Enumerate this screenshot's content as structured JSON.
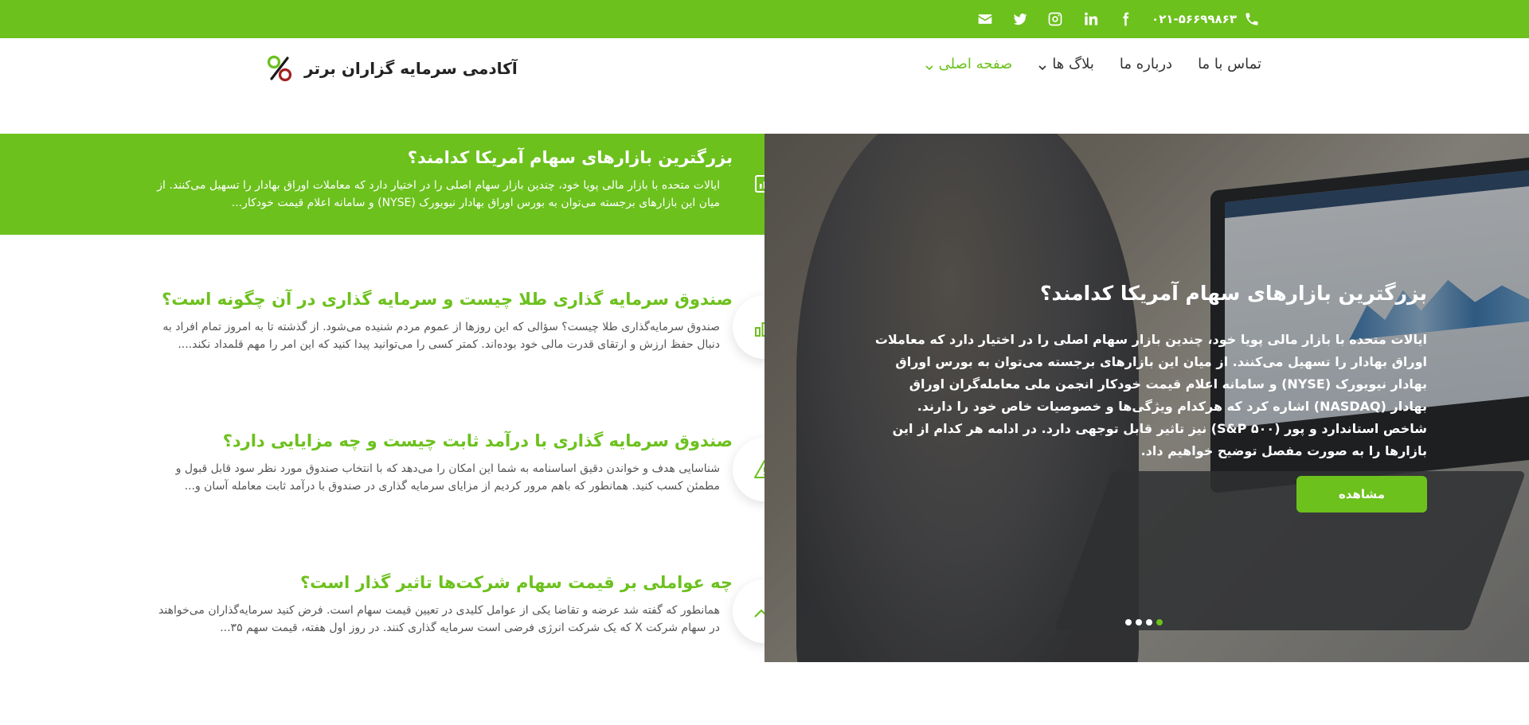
{
  "colors": {
    "accent": "#6cc11d",
    "header_bg": "#ffffff"
  },
  "topbar": {
    "phone": "۰۲۱-۵۶۶۹۹۸۶۳",
    "icons": [
      "phone-icon",
      "facebook-icon",
      "linkedin-icon",
      "instagram-icon",
      "twitter-icon",
      "mail-icon"
    ]
  },
  "nav": {
    "items": [
      {
        "label": "صفحه اصلی",
        "active": true,
        "has_dropdown": true
      },
      {
        "label": "بلاگ ها",
        "active": false,
        "has_dropdown": true
      },
      {
        "label": "درباره ما",
        "active": false,
        "has_dropdown": false
      },
      {
        "label": "تماس با ما",
        "active": false,
        "has_dropdown": false
      }
    ]
  },
  "logo": {
    "text": "آکادمی سرمایه گزاران برتر"
  },
  "posts": [
    {
      "title": "بزرگترین بازارهای سهام آمریکا کدامند؟",
      "excerpt": "ایالات متحده با بازار مالی پویا خود، چندین بازار سهام اصلی را در اختیار دارد که معاملات اوراق بهادار را تسهیل می‌کنند. از میان این بازارهای برجسته می‌توان به بورس اوراق بهادار نیویورک (NYSE) و سامانه اعلام قیمت خودکار...",
      "icon": "chart-board-icon"
    },
    {
      "title": "صندوق سرمایه گذاری طلا چیست و سرمایه گذاری در آن چگونه است؟",
      "excerpt": "صندوق سرمایه‌گذاری طلا چیست؟ سؤالی که این روزها از عموم مردم شنیده می‌شود. از گذشته تا به امروز تمام افراد به دنبال حفظ ارزش و ارتقای قدرت مالی خود بوده‌اند. کمتر کسی را می‌توانید پیدا کنید که این امر را مهم قلمداد نکند....",
      "icon": "bar-chart-icon"
    },
    {
      "title": "صندوق سرمایه گذاری با درآمد ثابت چیست و چه مزایایی دارد؟",
      "excerpt": "شناسایی هدف و خواندن دقیق اساسنامه به شما این امکان را می‌دهد که با انتخاب صندوق مورد نظر سود قابل قبول و مطمئن کسب کنید. همانطور که باهم مرور کردیم از مزایای سرمایه گذاری در صندوق با درآمد ثابت معامله آسان و...",
      "icon": "warning-icon"
    },
    {
      "title": "چه عواملی بر قیمت سهام شرکت‌ها تاثیر گذار است؟",
      "excerpt": "همانطور که گفته شد عرضه و تقاضا یکی از عوامل کلیدی در تعیین قیمت سهام است. فرض کنید سرمایه‌گذاران می‌خواهند در سهام شرکت X که یک شرکت انرژی فرضی است سرمایه گذاری کنند. در روز اول هفته، قیمت سهم ۳۵...",
      "icon": "trending-up-icon"
    }
  ],
  "slider": {
    "title": "بزرگترین بازارهای سهام آمریکا کدامند؟",
    "text": "ایالات متحده با بازار مالی پویا خود، چندین بازار سهام اصلی را در اختیار دارد که معاملات اوراق بهادار را تسهیل می‌کنند. از میان این بازارهای برجسته می‌توان به بورس اوراق بهادار نیویورک (NYSE) و سامانه اعلام قیمت خودکار انجمن ملی معامله‌گران اوراق بهادار (NASDAQ) اشاره کرد که هرکدام ویژگی‌ها و خصوصیات خاص خود را دارند. شاخص استاندارد و پور (S&P ۵۰۰) نیز تاثیر قابل توجهی دارد. در ادامه هر کدام از این بازارها را به صورت مفصل توضیح خواهیم داد.",
    "button_label": "مشاهده",
    "dot_count": 4,
    "active_dot": 1
  }
}
